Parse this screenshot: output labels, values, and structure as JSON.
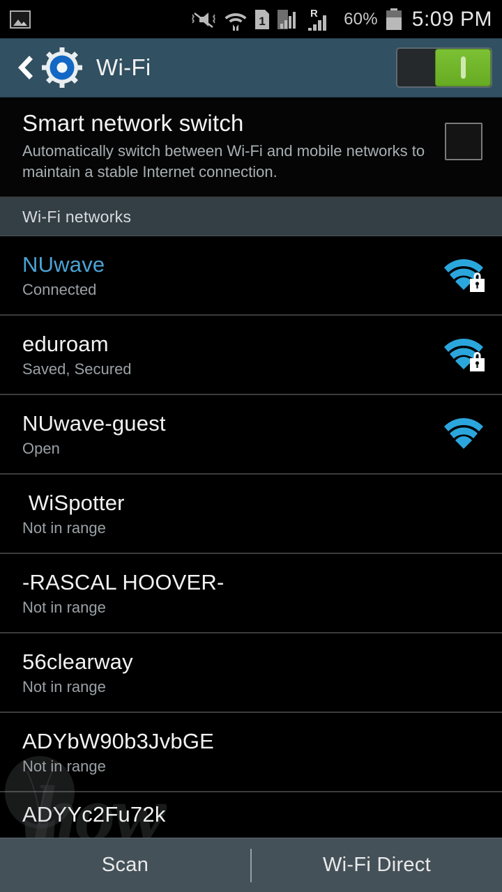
{
  "statusbar": {
    "icons": [
      "gallery-icon",
      "sound-mute-vibrate-icon",
      "wifi-transfer-icon",
      "sim1-icon",
      "signal-bars-icon",
      "roaming-icon",
      "signal-bars-2-icon"
    ],
    "battery_percent": "60%",
    "time": "5:09 PM"
  },
  "actionbar": {
    "back_label": "Back",
    "icon": "settings-gear-icon",
    "title": "Wi-Fi",
    "toggle_state": "ON",
    "toggle_color": "#6fb528"
  },
  "smart_network_switch": {
    "title": "Smart network switch",
    "description": "Automatically switch between Wi-Fi and mobile networks to maintain a stable Internet connection.",
    "checked": false
  },
  "section": {
    "header": "Wi-Fi networks"
  },
  "networks": [
    {
      "ssid": "NUwave",
      "status": "Connected",
      "icon": "wifi-secured-icon",
      "bars": 4,
      "secured": true,
      "connected": true
    },
    {
      "ssid": "eduroam",
      "status": "Saved, Secured",
      "icon": "wifi-secured-icon",
      "bars": 4,
      "secured": true,
      "connected": false
    },
    {
      "ssid": "NUwave-guest",
      "status": "Open",
      "icon": "wifi-open-icon",
      "bars": 4,
      "secured": false,
      "connected": false
    },
    {
      "ssid": " WiSpotter",
      "status": "Not in range",
      "icon": "",
      "bars": 0,
      "secured": false,
      "connected": false
    },
    {
      "ssid": "-RASCAL HOOVER-",
      "status": "Not in range",
      "icon": "",
      "bars": 0,
      "secured": false,
      "connected": false
    },
    {
      "ssid": "56clearway",
      "status": "Not in range",
      "icon": "",
      "bars": 0,
      "secured": false,
      "connected": false
    },
    {
      "ssid": "ADYbW90b3JvbGE",
      "status": "Not in range",
      "icon": "",
      "bars": 0,
      "secured": false,
      "connected": false
    },
    {
      "ssid": "ADYYc2Fu72k",
      "status": "",
      "icon": "",
      "bars": 0,
      "secured": false,
      "connected": false
    }
  ],
  "watermark": {
    "text": "how",
    "icon": "lightbulb-icon"
  },
  "bottombar": {
    "scan_label": "Scan",
    "wifi_direct_label": "Wi-Fi Direct"
  },
  "colors": {
    "actionbar_bg": "#315061",
    "section_bg": "#343e45",
    "connected_accent": "#4ba3d4",
    "wifi_icon": "#2ba6dd",
    "toggle_on": "#6fb528",
    "bottombar_bg": "#455159"
  }
}
